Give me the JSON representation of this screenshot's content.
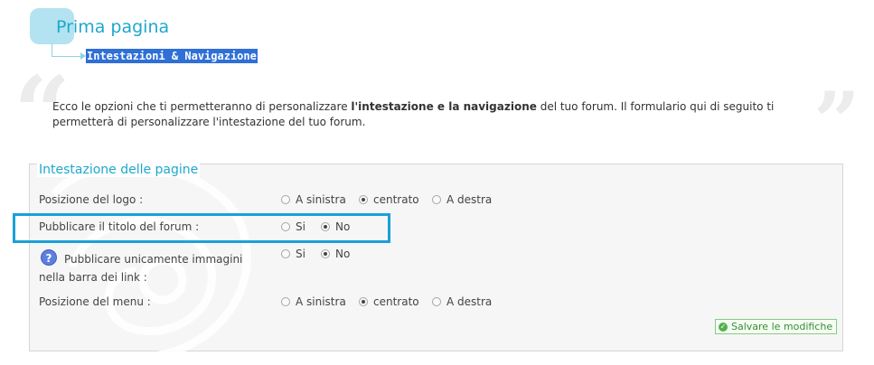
{
  "header": {
    "title": "Prima pagina",
    "breadcrumb": "Intestazioni & Navigazione"
  },
  "intro": {
    "part1": "Ecco le opzioni che ti permetteranno di personalizzare ",
    "bold": "l'intestazione e la navigazione",
    "part2": " del tuo forum. Il formulario qui di seguito ti permetterà di personalizzare l'intestazione del tuo forum."
  },
  "section": {
    "legend": "Intestazione delle pagine",
    "rows": [
      {
        "label": "Posizione del logo :",
        "options": [
          "A sinistra",
          "centrato",
          "A destra"
        ],
        "selected": "centrato"
      },
      {
        "label": "Pubblicare il titolo del forum :",
        "options": [
          "Si",
          "No"
        ],
        "selected": "No"
      },
      {
        "label": "Pubblicare unicamente immagini nella barra dei link :",
        "options": [
          "Si",
          "No"
        ],
        "selected": "No"
      },
      {
        "label": "Posizione del menu :",
        "options": [
          "A sinistra",
          "centrato",
          "A destra"
        ],
        "selected": "centrato"
      }
    ],
    "help_glyph": "?",
    "save_label": "Salvare le modifiche"
  },
  "colors": {
    "accent": "#1ea8cd",
    "highlight": "#1aa0d8",
    "breadcrumb_bg": "#2f6fd6",
    "save_green": "#3c8a3a"
  }
}
